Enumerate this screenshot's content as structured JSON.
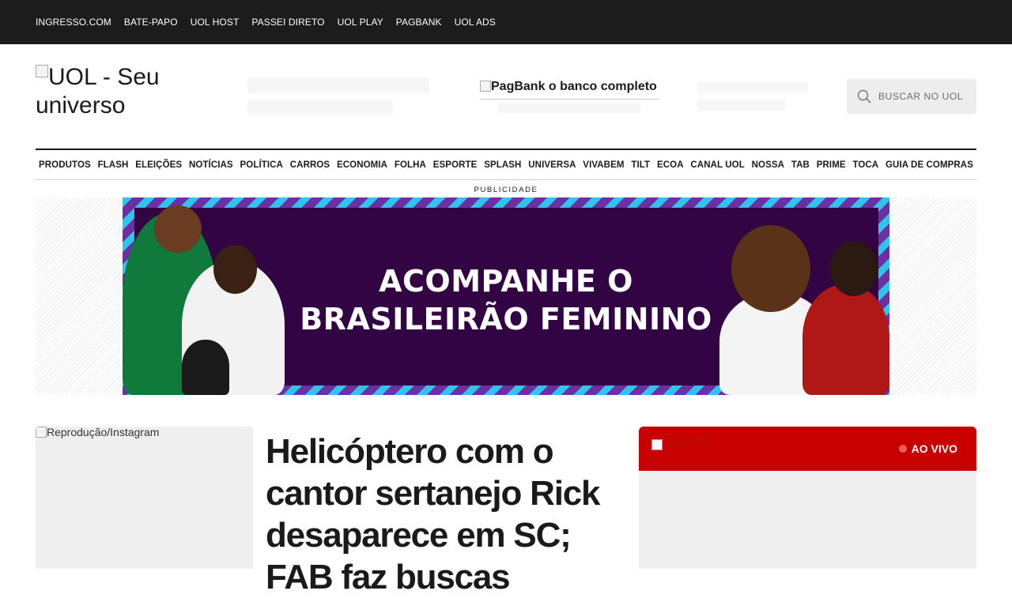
{
  "topbar": {
    "links": [
      "INGRESSO.COM",
      "BATE-PAPO",
      "UOL HOST",
      "PASSEI DIRETO",
      "UOL PLAY",
      "PAGBANK",
      "UOL ADS"
    ]
  },
  "header": {
    "logo_alt": "UOL - Seu universo",
    "pagbank_alt": "PagBank o banco completo",
    "search_placeholder": "BUSCAR NO UOL"
  },
  "nav": {
    "items": [
      "PRODUTOS",
      "FLASH",
      "ELEIÇÕES",
      "NOTÍCIAS",
      "POLÍTICA",
      "CARROS",
      "ECONOMIA",
      "FOLHA",
      "ESPORTE",
      "SPLASH",
      "UNIVERSA",
      "VIVABEM",
      "TILT",
      "ECOA",
      "CANAL UOL",
      "NOSSA",
      "TAB",
      "PRIME",
      "TOCA",
      "GUIA DE COMPRAS"
    ]
  },
  "ad": {
    "label": "PUBLICIDADE",
    "line1": "ACOMPANHE O",
    "line2": "BRASILEIRÃO FEMININO"
  },
  "story": {
    "image_alt": "Reprodução/Instagram",
    "headline": "Helicóptero com o cantor sertanejo Rick desaparece em SC; FAB faz buscas"
  },
  "live": {
    "image_alt": "Canal UOL",
    "badge": "AO VIVO"
  },
  "colors": {
    "topbar_bg": "#1c1c1c",
    "live_red": "#c80000",
    "ad_purple": "#330444",
    "ad_cyan": "#2fc4e8"
  }
}
